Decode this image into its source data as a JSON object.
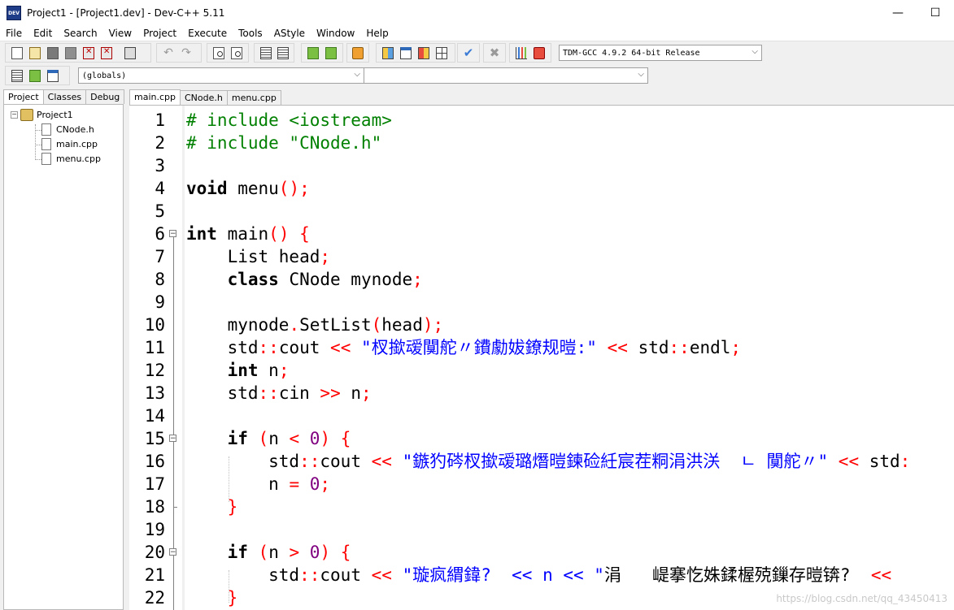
{
  "window": {
    "title": "Project1 - [Project1.dev] - Dev-C++ 5.11",
    "icon_text": "DEV"
  },
  "menu": [
    "File",
    "Edit",
    "Search",
    "View",
    "Project",
    "Execute",
    "Tools",
    "AStyle",
    "Window",
    "Help"
  ],
  "toolbar": {
    "compiler": "TDM-GCC 4.9.2 64-bit Release",
    "scope": "(globals)",
    "member": ""
  },
  "left_panel": {
    "tabs": [
      "Project",
      "Classes",
      "Debug"
    ],
    "active_tab": "Project",
    "tree": {
      "project": "Project1",
      "files": [
        "CNode.h",
        "main.cpp",
        "menu.cpp"
      ]
    }
  },
  "editor": {
    "tabs": [
      "main.cpp",
      "CNode.h",
      "menu.cpp"
    ],
    "active_tab": "main.cpp",
    "lines": [
      {
        "n": "1",
        "text": "# include <iostream>"
      },
      {
        "n": "2",
        "text": "# include \"CNode.h\""
      },
      {
        "n": "3",
        "text": ""
      },
      {
        "n": "4",
        "text": "void menu();"
      },
      {
        "n": "5",
        "text": ""
      },
      {
        "n": "6",
        "text": "int main() {"
      },
      {
        "n": "7",
        "text": "    List head;"
      },
      {
        "n": "8",
        "text": "    class CNode mynode;"
      },
      {
        "n": "9",
        "text": ""
      },
      {
        "n": "10",
        "text": "    mynode.SetList(head);"
      },
      {
        "n": "11",
        "text": "    std::cout << \"杈撳叆闃舵〃鐨勮妭鐐规暟:\" << std::endl;"
      },
      {
        "n": "12",
        "text": "    int n;"
      },
      {
        "n": "13",
        "text": "    std::cin >> n;"
      },
      {
        "n": "14",
        "text": ""
      },
      {
        "n": "15",
        "text": "    if (n < 0) {"
      },
      {
        "n": "16",
        "text": "        std::cout << \"鏃犳硶杈撳叆璐熸暟鍊硷紝宸茬粡涓洪浂  ㄴ 闃舵〃\" << std:"
      },
      {
        "n": "17",
        "text": "        n = 0;"
      },
      {
        "n": "18",
        "text": "    }"
      },
      {
        "n": "19",
        "text": ""
      },
      {
        "n": "20",
        "text": "    if (n > 0) {"
      },
      {
        "n": "21",
        "text": "        std::cout << \"璇疯緭鍏?  << n << \"涓   崼搴忔姝鍒楃殑鏁存暟锛?  <<"
      },
      {
        "n": "22",
        "text": "    }"
      }
    ]
  },
  "watermark": "https://blog.csdn.net/qq_43450413",
  "colors": {
    "preprocessor": "#008000",
    "symbol": "#ff0000",
    "string": "#0000ff",
    "number": "#800080",
    "keyword": "#000000"
  }
}
